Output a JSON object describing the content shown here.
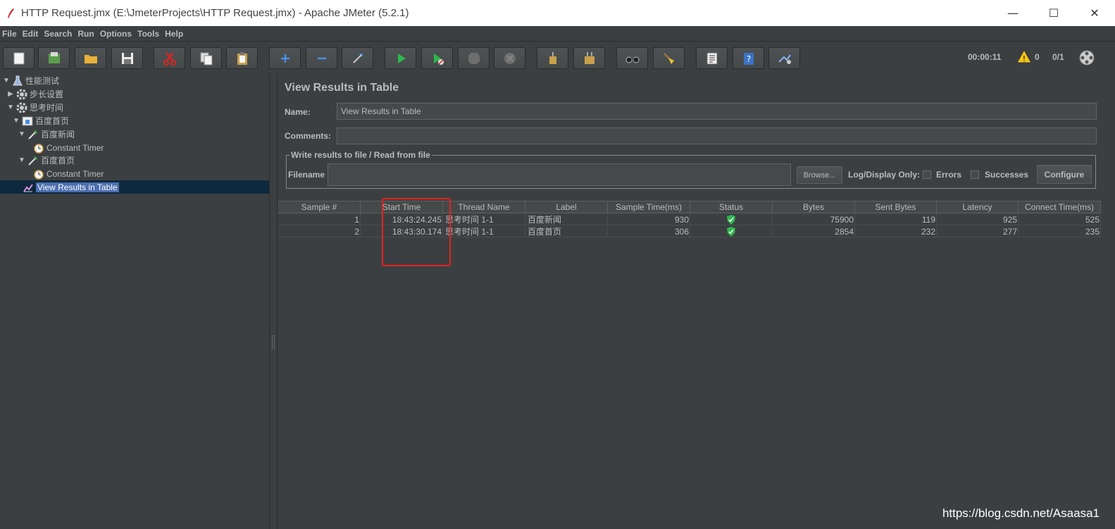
{
  "window": {
    "title": "HTTP Request.jmx (E:\\JmeterProjects\\HTTP Request.jmx) - Apache JMeter (5.2.1)",
    "minimize": "—",
    "maximize": "☐",
    "close": "✕"
  },
  "menu": [
    "File",
    "Edit",
    "Search",
    "Run",
    "Options",
    "Tools",
    "Help"
  ],
  "toolbar": {
    "elapsed": "00:00:11",
    "warnings": "0",
    "threads": "0/1"
  },
  "tree": [
    {
      "label": "性能测试",
      "icon": "flask-icon"
    },
    {
      "label": "步长设置",
      "icon": "gear-icon"
    },
    {
      "label": "思考时间",
      "icon": "gear-icon"
    },
    {
      "label": "百度首页",
      "icon": "controller-icon"
    },
    {
      "label": "百度新闻",
      "icon": "pipette-icon"
    },
    {
      "label": "Constant Timer",
      "icon": "timer-icon"
    },
    {
      "label": "百度首页",
      "icon": "pipette-icon"
    },
    {
      "label": "Constant Timer",
      "icon": "timer-icon"
    },
    {
      "label": "View Results in Table",
      "icon": "chart-icon"
    }
  ],
  "panel": {
    "title": "View Results in Table",
    "name_label": "Name:",
    "name_value": "View Results in Table",
    "comments_label": "Comments:",
    "comments_value": "",
    "file_legend": "Write results to file / Read from file",
    "filename_label": "Filename",
    "filename_value": "",
    "browse": "Browse...",
    "log_display": "Log/Display Only:",
    "errors": "Errors",
    "successes": "Successes",
    "configure": "Configure"
  },
  "table": {
    "headers": [
      "Sample #",
      "Start Time",
      "Thread Name",
      "Label",
      "Sample Time(ms)",
      "Status",
      "Bytes",
      "Sent Bytes",
      "Latency",
      "Connect Time(ms)"
    ],
    "rows": [
      [
        "1",
        "18:43:24.245",
        "思考时间 1-1",
        "百度新闻",
        "930",
        "success",
        "75900",
        "119",
        "925",
        "525"
      ],
      [
        "2",
        "18:43:30.174",
        "思考时间 1-1",
        "百度首页",
        "306",
        "success",
        "2854",
        "232",
        "277",
        "235"
      ]
    ]
  },
  "watermark": "https://blog.csdn.net/Asaasa1",
  "colors": {
    "highlight": "#e8211e",
    "selection": "#4b6eaf",
    "status_ok": "#2db84d"
  }
}
